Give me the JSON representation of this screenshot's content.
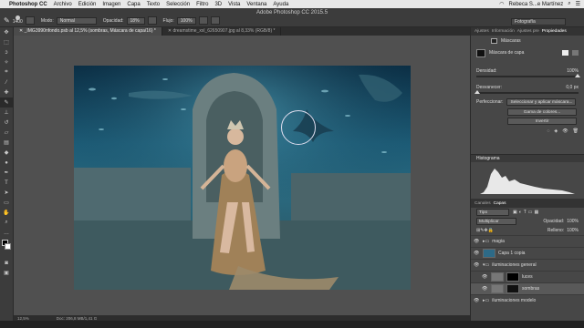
{
  "menubar": {
    "app": "Photoshop CC",
    "items": [
      "Archivo",
      "Edición",
      "Imagen",
      "Capa",
      "Texto",
      "Selección",
      "Filtro",
      "3D",
      "Vista",
      "Ventana",
      "Ayuda"
    ],
    "user": "Rebeca S...e Martínez"
  },
  "options": {
    "brush_size": "1400",
    "mode_label": "Modo:",
    "mode_value": "Normal",
    "opacity_label": "Opacidad:",
    "opacity_value": "18%",
    "flow_label": "Flujo:",
    "flow_value": "100%"
  },
  "app_title": "Adobe Photoshop CC 2015.5",
  "workspace": "Fotografía",
  "tabs": [
    {
      "label": "_IMG3990nfondo.psb al 12,5% (sombras, Máscara de capa/16) *"
    },
    {
      "label": "dreamstime_xxl_62650907.jpg al 8,33% (RGB/8) *"
    }
  ],
  "status": {
    "zoom": "12,5%",
    "doc": "Doc: 206,8 MB/1,41 G"
  },
  "properties": {
    "tabs": [
      "Ajustes",
      "Información",
      "Ajustes pre",
      "Propiedades"
    ],
    "mask_label": "Máscaras",
    "layer_mask_label": "Máscara de capa",
    "density_label": "Densidad:",
    "density_value": "100%",
    "feather_label": "Desvanecer:",
    "feather_value": "0,0 px",
    "refine_label": "Perfeccionar:",
    "btn_select_mask": "Seleccionar y aplicar máscara...",
    "btn_color_range": "Gama de colores...",
    "btn_invert": "Invertir"
  },
  "histogram": {
    "title": "Histograma"
  },
  "layers_panel": {
    "tabs": [
      "Canales",
      "Capas"
    ],
    "filter": "Tipo",
    "blend": "Multiplicar",
    "opacity_label": "Opacidad:",
    "opacity_value": "100%",
    "fill_label": "Relleno:",
    "fill_value": "100%",
    "layers": [
      {
        "name": "magia"
      },
      {
        "name": "Capa 1 copia"
      },
      {
        "name": "iluminaciones general"
      },
      {
        "name": "luces"
      },
      {
        "name": "sombras"
      },
      {
        "name": "iluminaciones modelo"
      }
    ]
  }
}
